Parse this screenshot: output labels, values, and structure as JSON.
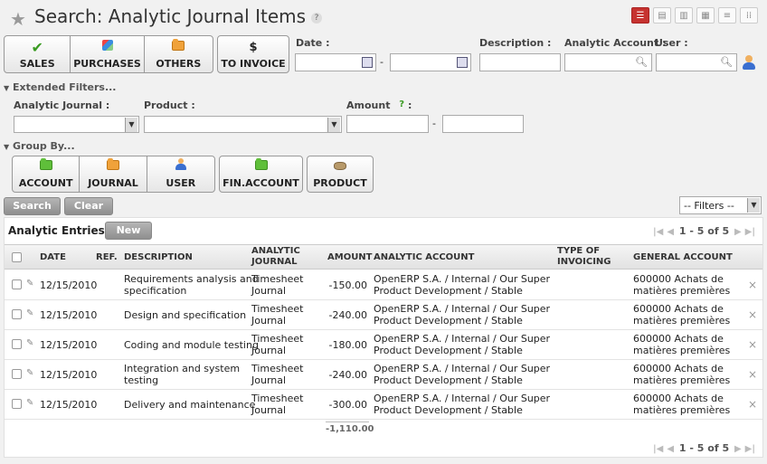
{
  "header": {
    "title": "Search: Analytic Journal Items",
    "help": "?"
  },
  "views": [
    "list-view-icon",
    "form-view-icon",
    "graph-view-icon",
    "calendar-view-icon",
    "gantt-view-icon",
    "kanban-view-icon"
  ],
  "filters": {
    "journal_buttons": [
      {
        "label": "SALES",
        "icon": "checkmark-icon"
      },
      {
        "label": "PURCHASES",
        "icon": "purchases-icon"
      },
      {
        "label": "OTHERS",
        "icon": "folder-icon"
      }
    ],
    "invoice_button": {
      "label": "TO INVOICE",
      "icon": "$"
    },
    "date_label": "Date :",
    "description_label": "Description :",
    "analytic_account_label": "Analytic Account :",
    "user_label": "User :",
    "dash": "-"
  },
  "extended": {
    "toggle": "Extended Filters...",
    "journal_label": "Analytic Journal :",
    "product_label": "Product :",
    "amount_label": "Amount",
    "amount_help": "?",
    "colon": ":"
  },
  "groupby": {
    "toggle": "Group By...",
    "buttons": [
      {
        "label": "ACCOUNT"
      },
      {
        "label": "JOURNAL"
      },
      {
        "label": "USER"
      }
    ],
    "fin_account": "FIN.ACCOUNT",
    "product": "PRODUCT"
  },
  "actions": {
    "search": "Search",
    "clear": "Clear",
    "filters_select": "-- Filters --"
  },
  "list": {
    "title": "Analytic Entries",
    "new_button": "New",
    "pager_top": "1 - 5 of 5",
    "pager_bottom": "1 - 5 of 5",
    "columns": {
      "date": "DATE",
      "ref": "REF.",
      "description": "DESCRIPTION",
      "journal_1": "ANALYTIC",
      "journal_2": "JOURNAL",
      "amount": "AMOUNT",
      "account": "ANALYTIC ACCOUNT",
      "invoicing_1": "TYPE OF",
      "invoicing_2": "INVOICING",
      "general": "GENERAL ACCOUNT"
    },
    "rows": [
      {
        "date": "12/15/2010",
        "desc1": "Requirements analysis and",
        "desc2": "specification",
        "journal1": "Timesheet",
        "journal2": "Journal",
        "amount": "-150.00",
        "account1": "OpenERP S.A. / Internal / Our Super",
        "account2": "Product Development / Stable",
        "general1": "600000 Achats de",
        "general2": "matières premières"
      },
      {
        "date": "12/15/2010",
        "desc1": "Design and specification",
        "desc2": "",
        "journal1": "Timesheet",
        "journal2": "Journal",
        "amount": "-240.00",
        "account1": "OpenERP S.A. / Internal / Our Super",
        "account2": "Product Development / Stable",
        "general1": "600000 Achats de",
        "general2": "matières premières"
      },
      {
        "date": "12/15/2010",
        "desc1": "Coding and module testing",
        "desc2": "",
        "journal1": "Timesheet",
        "journal2": "Journal",
        "amount": "-180.00",
        "account1": "OpenERP S.A. / Internal / Our Super",
        "account2": "Product Development / Stable",
        "general1": "600000 Achats de",
        "general2": "matières premières"
      },
      {
        "date": "12/15/2010",
        "desc1": "Integration and system",
        "desc2": "testing",
        "journal1": "Timesheet",
        "journal2": "Journal",
        "amount": "-240.00",
        "account1": "OpenERP S.A. / Internal / Our Super",
        "account2": "Product Development / Stable",
        "general1": "600000 Achats de",
        "general2": "matières premières"
      },
      {
        "date": "12/15/2010",
        "desc1": "Delivery and maintenance",
        "desc2": "",
        "journal1": "Timesheet",
        "journal2": "Journal",
        "amount": "-300.00",
        "account1": "OpenERP S.A. / Internal / Our Super",
        "account2": "Product Development / Stable",
        "general1": "600000 Achats de",
        "general2": "matières premières"
      }
    ],
    "total": "-1,110.00"
  }
}
